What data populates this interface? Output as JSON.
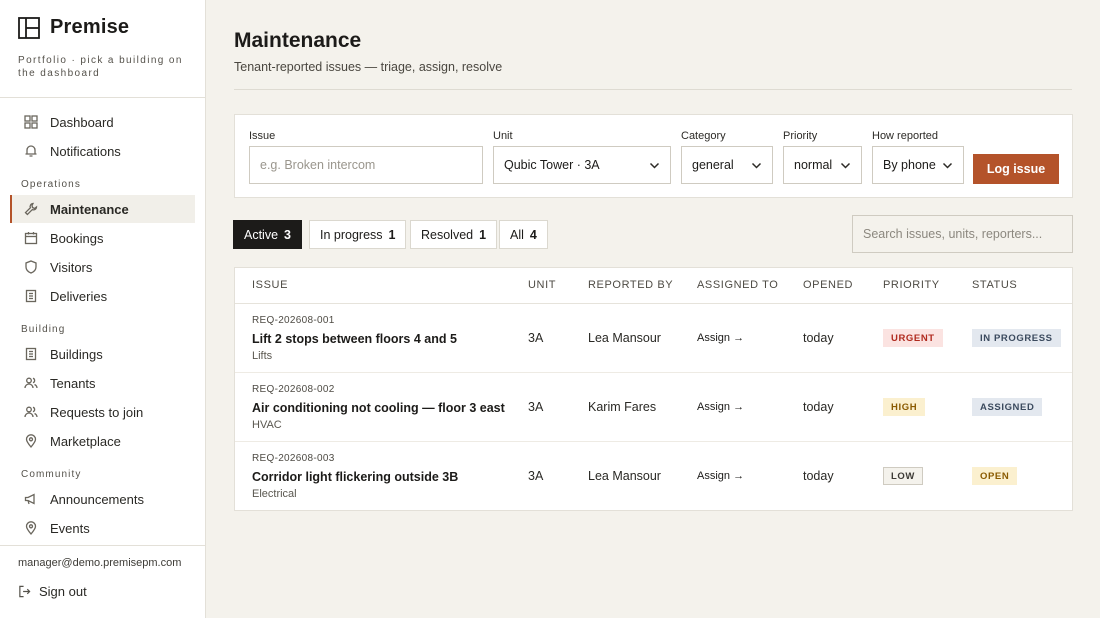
{
  "brand": {
    "name": "Premise",
    "subtitle": "Portfolio · pick a building on the dashboard"
  },
  "sidebar": {
    "top_items": [
      {
        "label": "Dashboard",
        "icon": "grid-icon"
      },
      {
        "label": "Notifications",
        "icon": "bell-icon"
      }
    ],
    "sections": [
      {
        "title": "Operations",
        "items": [
          {
            "label": "Maintenance",
            "icon": "wrench-icon",
            "active": true
          },
          {
            "label": "Bookings",
            "icon": "calendar-icon"
          },
          {
            "label": "Visitors",
            "icon": "shield-icon"
          },
          {
            "label": "Deliveries",
            "icon": "package-icon"
          }
        ]
      },
      {
        "title": "Building",
        "items": [
          {
            "label": "Buildings",
            "icon": "building-icon"
          },
          {
            "label": "Tenants",
            "icon": "users-icon"
          },
          {
            "label": "Requests to join",
            "icon": "users-plus-icon"
          },
          {
            "label": "Marketplace",
            "icon": "pin-icon"
          }
        ]
      },
      {
        "title": "Community",
        "items": [
          {
            "label": "Announcements",
            "icon": "megaphone-icon"
          },
          {
            "label": "Events",
            "icon": "pin-icon"
          }
        ]
      }
    ],
    "user_email": "manager@demo.premisepm.com",
    "signout_label": "Sign out"
  },
  "page": {
    "title": "Maintenance",
    "subtitle": "Tenant-reported issues — triage, assign, resolve"
  },
  "form": {
    "issue_label": "Issue",
    "issue_placeholder": "e.g. Broken intercom",
    "unit_label": "Unit",
    "unit_value": "Qubic Tower · 3A",
    "category_label": "Category",
    "category_value": "general",
    "priority_label": "Priority",
    "priority_value": "normal",
    "reported_label": "How reported",
    "reported_value": "By phone",
    "submit_label": "Log issue"
  },
  "tabs": [
    {
      "label": "Active",
      "count": "3",
      "active": true
    },
    {
      "label": "In progress",
      "count": "1"
    },
    {
      "label": "Resolved",
      "count": "1"
    },
    {
      "label": "All",
      "count": "4"
    }
  ],
  "search": {
    "placeholder": "Search issues, units, reporters..."
  },
  "table": {
    "headers": [
      "ISSUE",
      "UNIT",
      "REPORTED BY",
      "ASSIGNED TO",
      "OPENED",
      "PRIORITY",
      "STATUS"
    ],
    "rows": [
      {
        "id": "REQ-202608-001",
        "title": "Lift 2 stops between floors 4 and 5",
        "category": "Lifts",
        "unit": "3A",
        "reporter": "Lea Mansour",
        "assign": "Assign →",
        "opened": "today",
        "priority": "URGENT",
        "status": "IN PROGRESS"
      },
      {
        "id": "REQ-202608-002",
        "title": "Air conditioning not cooling — floor 3 east",
        "category": "HVAC",
        "unit": "3A",
        "reporter": "Karim Fares",
        "assign": "Assign →",
        "opened": "today",
        "priority": "HIGH",
        "status": "ASSIGNED"
      },
      {
        "id": "REQ-202608-003",
        "title": "Corridor light flickering outside 3B",
        "category": "Electrical",
        "unit": "3A",
        "reporter": "Lea Mansour",
        "assign": "Assign →",
        "opened": "today",
        "priority": "LOW",
        "status": "OPEN"
      }
    ]
  },
  "colors": {
    "accent": "#b4532a",
    "urgent_bg": "#fbe3e1",
    "urgent_fg": "#b02a1e",
    "high_bg": "#fbf0cf",
    "high_fg": "#8a5a00",
    "low_bg": "#f4f2ec",
    "low_fg": "#3d3b36",
    "inprogress_bg": "#e3e8ef",
    "inprogress_fg": "#3b4a5e",
    "assigned_bg": "#e3e8ef",
    "assigned_fg": "#3b4a5e",
    "open_bg": "#fbf0cf",
    "open_fg": "#8a5a00"
  }
}
